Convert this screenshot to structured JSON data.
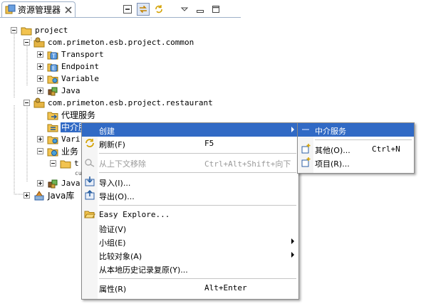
{
  "view": {
    "title": "资源管理器",
    "toolbar": [
      "collapse-all-icon",
      "link-with-editor-icon",
      "sync-icon",
      "view-menu-icon",
      "minimize-icon",
      "maximize-icon"
    ]
  },
  "tree": {
    "project": "project",
    "common_pkg": "com.primeton.esb.project.common",
    "common_children": [
      "Transport",
      "Endpoint",
      "Variable",
      "Java"
    ],
    "restaurant_pkg": "com.primeton.esb.project.restaurant",
    "restaurant_children": [
      "代理服务",
      "中介服务",
      "Vari",
      "业务",
      "t",
      "cu",
      "Java"
    ],
    "java_lib": "Java库"
  },
  "context_menu": {
    "items": [
      {
        "label": "创建",
        "accel": "",
        "submenu": true,
        "highlighted": true,
        "disabled": false
      },
      {
        "label": "刷新(F)",
        "accel": "F5"
      },
      {
        "label": "从上下文移除",
        "accel": "Ctrl+Alt+Shift+向下",
        "disabled": true
      },
      {
        "label": "导入(I)...",
        "accel": ""
      },
      {
        "label": "导出(O)...",
        "accel": ""
      },
      {
        "label": "Easy Explore...",
        "accel": ""
      },
      {
        "label": "验证(V)",
        "accel": ""
      },
      {
        "label": "小组(E)",
        "accel": "",
        "submenu": true
      },
      {
        "label": "比较对象(A)",
        "accel": "",
        "submenu": true
      },
      {
        "label": "从本地历史记录复原(Y)...",
        "accel": ""
      },
      {
        "label": "属性(R)",
        "accel": "Alt+Enter"
      }
    ]
  },
  "submenu": {
    "items": [
      {
        "label": "中介服务",
        "highlighted": true
      },
      {
        "label": "其他(O)...",
        "accel": "Ctrl+N"
      },
      {
        "label": "项目(R)...",
        "accel": ""
      }
    ]
  },
  "colors": {
    "selection": "#316ac5",
    "folder": "#f2c34f",
    "package": "#c9a03f"
  }
}
